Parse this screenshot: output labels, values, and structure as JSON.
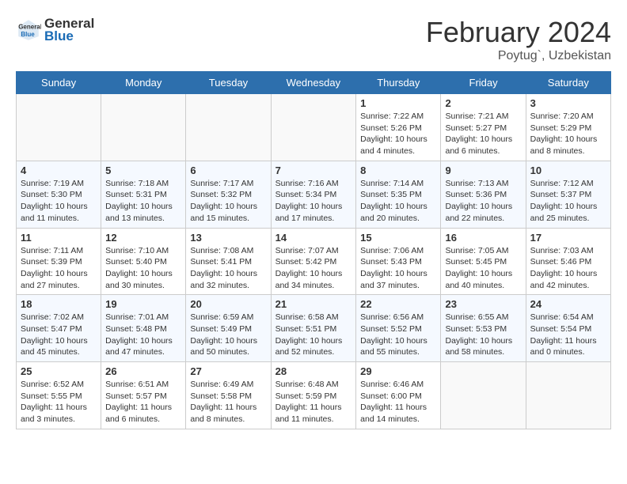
{
  "header": {
    "logo_general": "General",
    "logo_blue": "Blue",
    "month_title": "February 2024",
    "location": "Poytug`, Uzbekistan"
  },
  "days_of_week": [
    "Sunday",
    "Monday",
    "Tuesday",
    "Wednesday",
    "Thursday",
    "Friday",
    "Saturday"
  ],
  "weeks": [
    [
      {
        "day": "",
        "info": ""
      },
      {
        "day": "",
        "info": ""
      },
      {
        "day": "",
        "info": ""
      },
      {
        "day": "",
        "info": ""
      },
      {
        "day": "1",
        "info": "Sunrise: 7:22 AM\nSunset: 5:26 PM\nDaylight: 10 hours\nand 4 minutes."
      },
      {
        "day": "2",
        "info": "Sunrise: 7:21 AM\nSunset: 5:27 PM\nDaylight: 10 hours\nand 6 minutes."
      },
      {
        "day": "3",
        "info": "Sunrise: 7:20 AM\nSunset: 5:29 PM\nDaylight: 10 hours\nand 8 minutes."
      }
    ],
    [
      {
        "day": "4",
        "info": "Sunrise: 7:19 AM\nSunset: 5:30 PM\nDaylight: 10 hours\nand 11 minutes."
      },
      {
        "day": "5",
        "info": "Sunrise: 7:18 AM\nSunset: 5:31 PM\nDaylight: 10 hours\nand 13 minutes."
      },
      {
        "day": "6",
        "info": "Sunrise: 7:17 AM\nSunset: 5:32 PM\nDaylight: 10 hours\nand 15 minutes."
      },
      {
        "day": "7",
        "info": "Sunrise: 7:16 AM\nSunset: 5:34 PM\nDaylight: 10 hours\nand 17 minutes."
      },
      {
        "day": "8",
        "info": "Sunrise: 7:14 AM\nSunset: 5:35 PM\nDaylight: 10 hours\nand 20 minutes."
      },
      {
        "day": "9",
        "info": "Sunrise: 7:13 AM\nSunset: 5:36 PM\nDaylight: 10 hours\nand 22 minutes."
      },
      {
        "day": "10",
        "info": "Sunrise: 7:12 AM\nSunset: 5:37 PM\nDaylight: 10 hours\nand 25 minutes."
      }
    ],
    [
      {
        "day": "11",
        "info": "Sunrise: 7:11 AM\nSunset: 5:39 PM\nDaylight: 10 hours\nand 27 minutes."
      },
      {
        "day": "12",
        "info": "Sunrise: 7:10 AM\nSunset: 5:40 PM\nDaylight: 10 hours\nand 30 minutes."
      },
      {
        "day": "13",
        "info": "Sunrise: 7:08 AM\nSunset: 5:41 PM\nDaylight: 10 hours\nand 32 minutes."
      },
      {
        "day": "14",
        "info": "Sunrise: 7:07 AM\nSunset: 5:42 PM\nDaylight: 10 hours\nand 34 minutes."
      },
      {
        "day": "15",
        "info": "Sunrise: 7:06 AM\nSunset: 5:43 PM\nDaylight: 10 hours\nand 37 minutes."
      },
      {
        "day": "16",
        "info": "Sunrise: 7:05 AM\nSunset: 5:45 PM\nDaylight: 10 hours\nand 40 minutes."
      },
      {
        "day": "17",
        "info": "Sunrise: 7:03 AM\nSunset: 5:46 PM\nDaylight: 10 hours\nand 42 minutes."
      }
    ],
    [
      {
        "day": "18",
        "info": "Sunrise: 7:02 AM\nSunset: 5:47 PM\nDaylight: 10 hours\nand 45 minutes."
      },
      {
        "day": "19",
        "info": "Sunrise: 7:01 AM\nSunset: 5:48 PM\nDaylight: 10 hours\nand 47 minutes."
      },
      {
        "day": "20",
        "info": "Sunrise: 6:59 AM\nSunset: 5:49 PM\nDaylight: 10 hours\nand 50 minutes."
      },
      {
        "day": "21",
        "info": "Sunrise: 6:58 AM\nSunset: 5:51 PM\nDaylight: 10 hours\nand 52 minutes."
      },
      {
        "day": "22",
        "info": "Sunrise: 6:56 AM\nSunset: 5:52 PM\nDaylight: 10 hours\nand 55 minutes."
      },
      {
        "day": "23",
        "info": "Sunrise: 6:55 AM\nSunset: 5:53 PM\nDaylight: 10 hours\nand 58 minutes."
      },
      {
        "day": "24",
        "info": "Sunrise: 6:54 AM\nSunset: 5:54 PM\nDaylight: 11 hours\nand 0 minutes."
      }
    ],
    [
      {
        "day": "25",
        "info": "Sunrise: 6:52 AM\nSunset: 5:55 PM\nDaylight: 11 hours\nand 3 minutes."
      },
      {
        "day": "26",
        "info": "Sunrise: 6:51 AM\nSunset: 5:57 PM\nDaylight: 11 hours\nand 6 minutes."
      },
      {
        "day": "27",
        "info": "Sunrise: 6:49 AM\nSunset: 5:58 PM\nDaylight: 11 hours\nand 8 minutes."
      },
      {
        "day": "28",
        "info": "Sunrise: 6:48 AM\nSunset: 5:59 PM\nDaylight: 11 hours\nand 11 minutes."
      },
      {
        "day": "29",
        "info": "Sunrise: 6:46 AM\nSunset: 6:00 PM\nDaylight: 11 hours\nand 14 minutes."
      },
      {
        "day": "",
        "info": ""
      },
      {
        "day": "",
        "info": ""
      }
    ]
  ]
}
